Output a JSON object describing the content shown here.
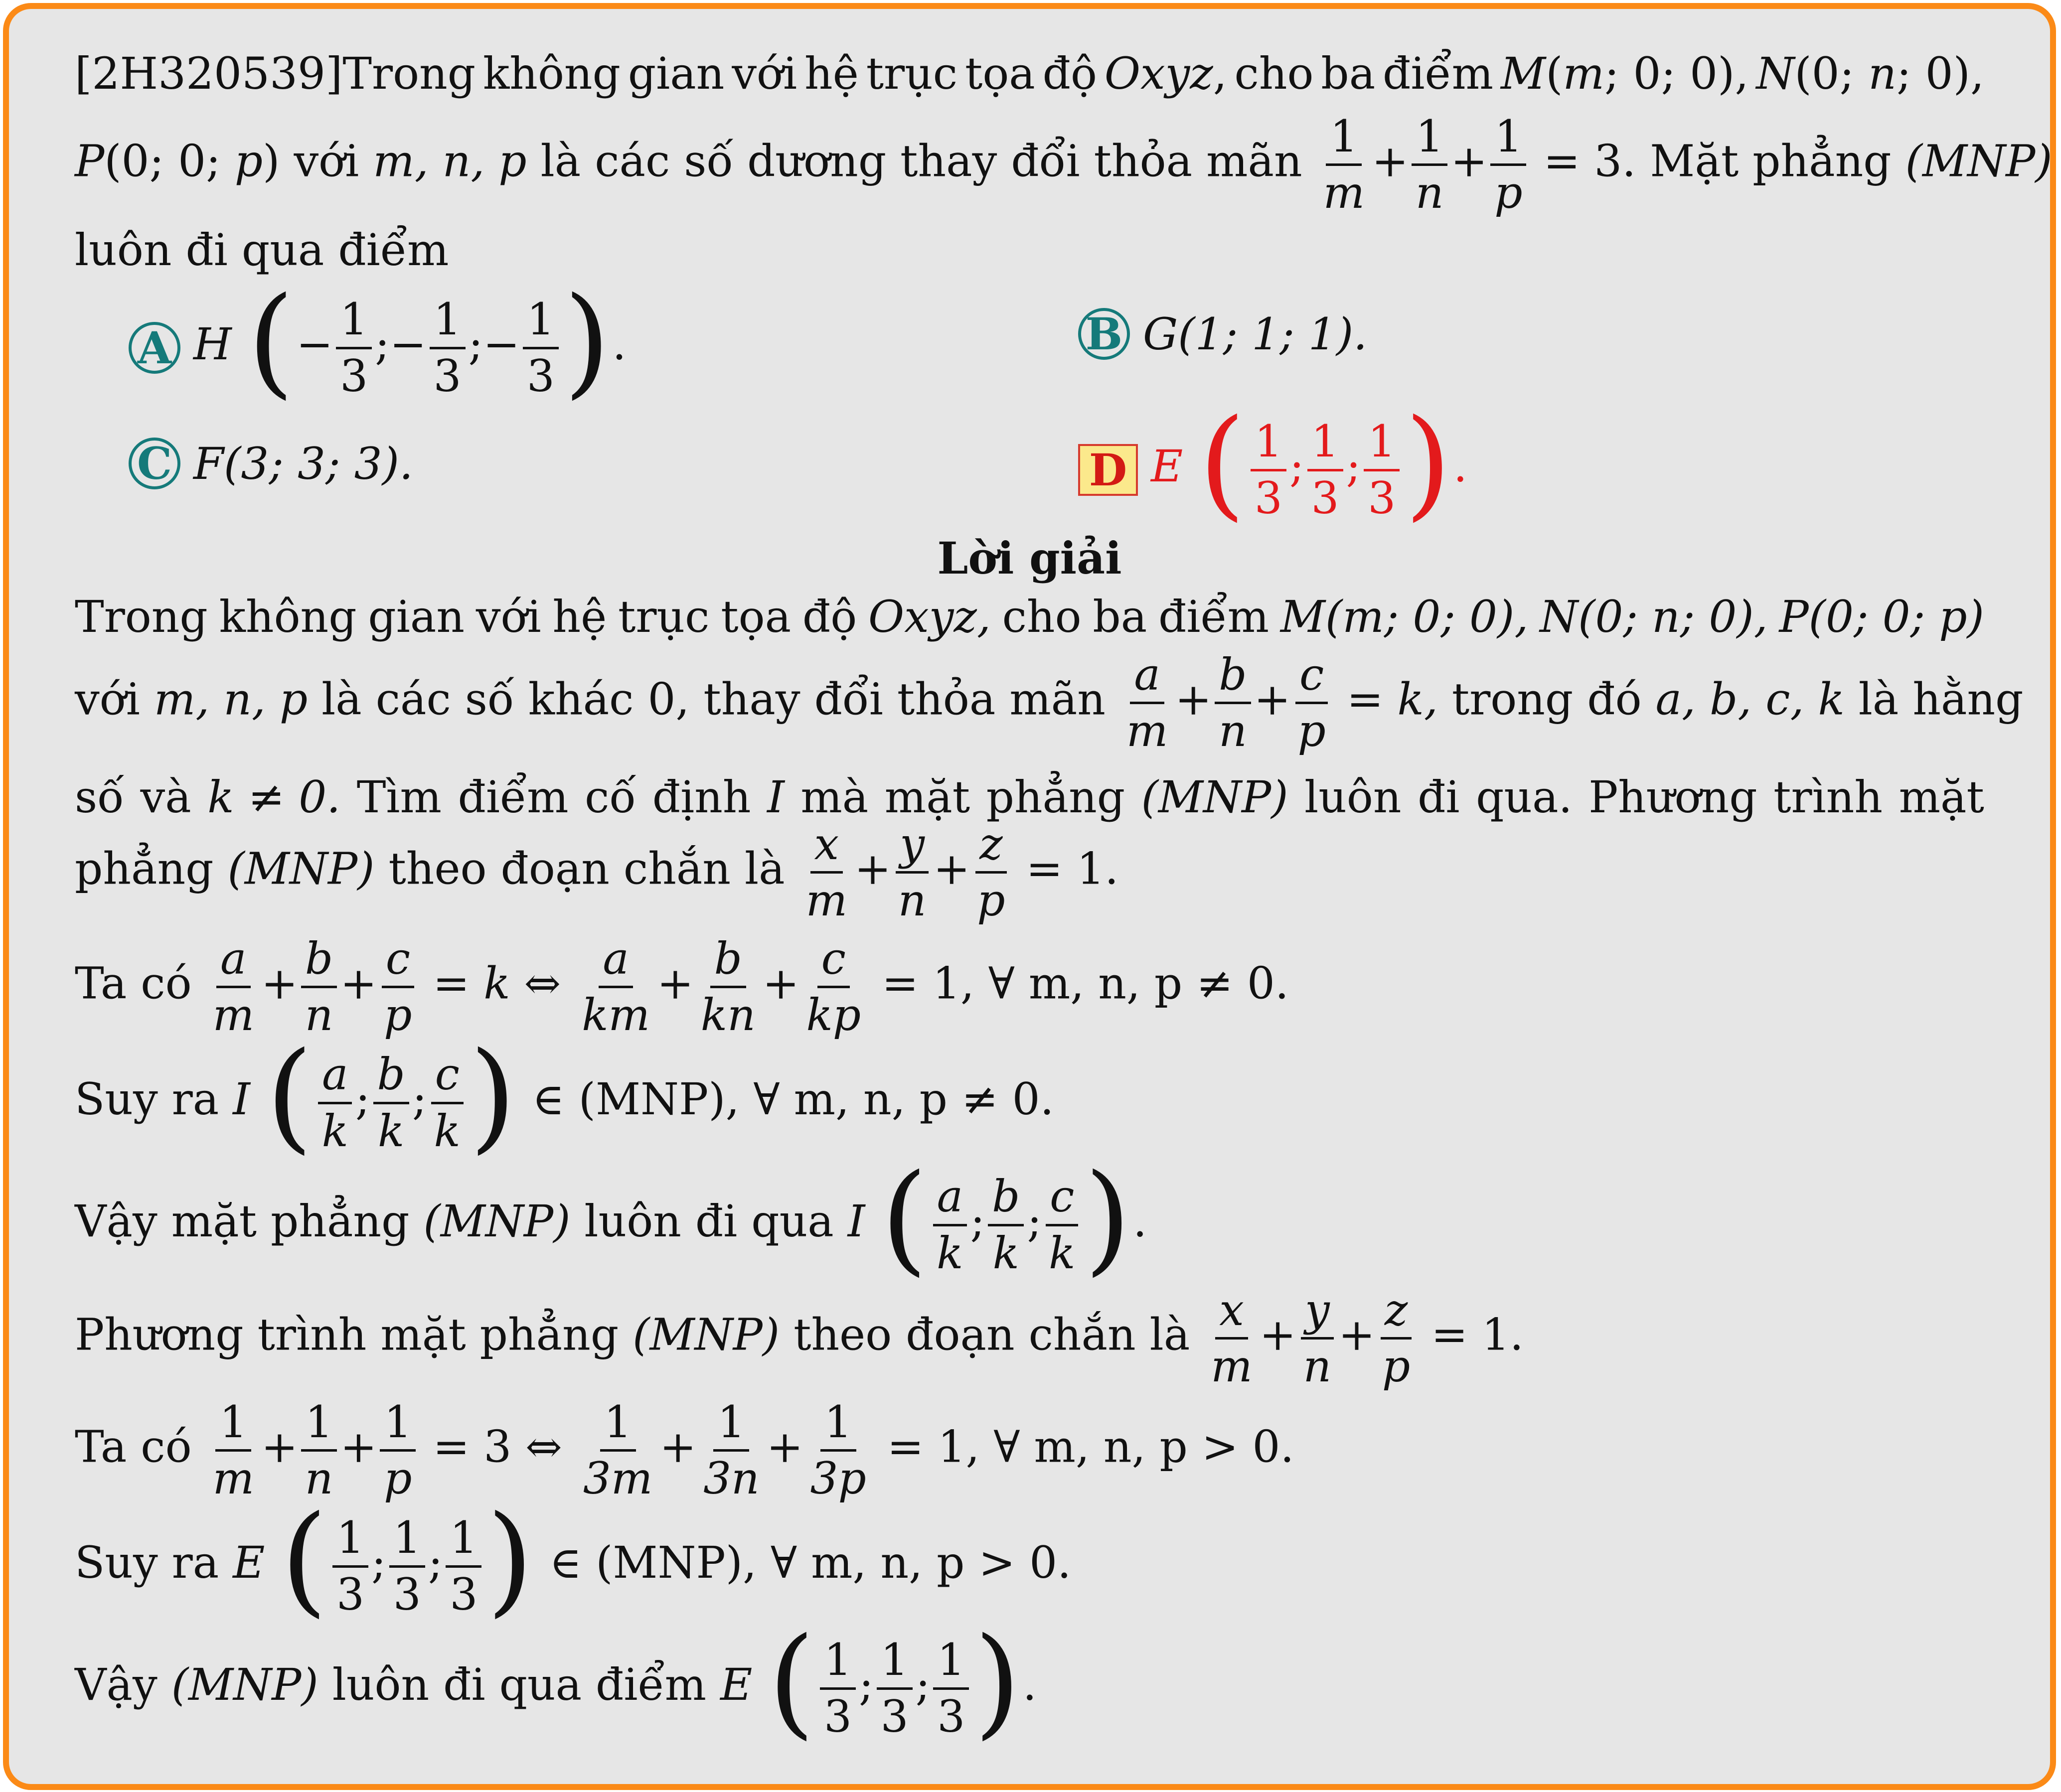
{
  "question": {
    "code": "[2H320539]",
    "line1": {
      "w1": "Trong",
      "w2": "không",
      "w3": "gian",
      "w4": "với",
      "w5": "hệ",
      "w6": "trục",
      "w7": "tọa",
      "w8": "độ",
      "oxyz": "Oxyz",
      "comma1": ",",
      "w9": "cho",
      "w10": "ba",
      "w11": "điểm",
      "M": "M",
      "m": "m",
      "zero": "0",
      "N": "N",
      "n": "n"
    },
    "line2": {
      "P": "P",
      "p": "p",
      "voi": "với",
      "vars": "m, n, p",
      "text": "là các số dương thay đổi thỏa mãn",
      "one": "1",
      "plus": "+",
      "rhs": "= 3.",
      "mat": "Mặt phẳng",
      "mnp": "(MNP)"
    },
    "line3": "luôn đi qua điểm"
  },
  "choices": {
    "A": {
      "label": "A",
      "point": "H",
      "minus": "−",
      "one": "1",
      "three": "3",
      "end": "."
    },
    "B": {
      "label": "B",
      "text": "G(1; 1; 1)."
    },
    "C": {
      "label": "C",
      "text": "F(3; 3; 3)."
    },
    "D": {
      "label": "D",
      "point": "E",
      "one": "1",
      "three": "3",
      "end": "."
    }
  },
  "solution": {
    "heading": "Lời giải",
    "p1_line1": {
      "w1": "Trong",
      "w2": "không",
      "w3": "gian",
      "w4": "với",
      "w5": "hệ",
      "w6": "trục",
      "w7": "tọa",
      "w8": "độ",
      "oxyz": "Oxyz,",
      "w9": "cho",
      "w10": "ba",
      "w11": "điểm",
      "M": "M(m; 0; 0),",
      "N": "N(0; n; 0),",
      "P": "P(0; 0; p)"
    },
    "p1_line2": {
      "pre": "với",
      "vars": "m, n, p",
      "text": "là các số khác 0, thay đổi thỏa mãn",
      "a": "a",
      "b": "b",
      "c": "c",
      "m": "m",
      "n": "n",
      "p": "p",
      "plus": "+",
      "eqk": "= k,",
      "w1": "trong",
      "w2": "đó",
      "abck": "a, b, c, k",
      "w3": "là",
      "w4": "hằng"
    },
    "p1_line3": {
      "w1": "số",
      "w2": "và",
      "k": "k ≠ 0.",
      "w3": "Tìm",
      "w4": "điểm",
      "w5": "cố",
      "w6": "định",
      "I": "I",
      "w7": "mà",
      "w8": "mặt",
      "w9": "phẳng",
      "mnp": "(MNP)",
      "w10": "luôn",
      "w11": "đi",
      "w12": "qua.",
      "w13": "Phương",
      "w14": "trình",
      "w15": "mặt"
    },
    "p1_line4": {
      "text": "phẳng",
      "mnp": "(MNP)",
      "text2": "theo đoạn chắn là",
      "x": "x",
      "y": "y",
      "z": "z",
      "m": "m",
      "n": "n",
      "p": "p",
      "plus": "+",
      "eq1": "= 1."
    },
    "l5": {
      "pre": "Ta có",
      "a": "a",
      "b": "b",
      "c": "c",
      "m": "m",
      "n": "n",
      "p": "p",
      "km": "km",
      "kn": "kn",
      "kp": "kp",
      "plus": "+",
      "eqk": "= k ⇔",
      "tail": "= 1, ∀ m, n, p ≠ 0."
    },
    "l6": {
      "pre": "Suy ra",
      "I": "I",
      "a": "a",
      "b": "b",
      "c": "c",
      "k": "k",
      "tail": "∈ (MNP), ∀ m, n, p ≠ 0."
    },
    "l7": {
      "pre": "Vậy mặt phẳng",
      "mnp": "(MNP)",
      "mid": "luôn đi qua",
      "I": "I",
      "a": "a",
      "b": "b",
      "c": "c",
      "k": "k",
      "end": "."
    },
    "l8": {
      "pre": "Phương trình mặt phẳng",
      "mnp": "(MNP)",
      "mid": "theo đoạn chắn là",
      "x": "x",
      "y": "y",
      "z": "z",
      "m": "m",
      "n": "n",
      "p": "p",
      "plus": "+",
      "eq1": "= 1."
    },
    "l9": {
      "pre": "Ta có",
      "one": "1",
      "m": "m",
      "n": "n",
      "p": "p",
      "m3": "3m",
      "n3": "3n",
      "p3": "3p",
      "plus": "+",
      "eq3": "= 3 ⇔",
      "tail": "= 1, ∀ m, n, p > 0."
    },
    "l10": {
      "pre": "Suy ra",
      "E": "E",
      "one": "1",
      "three": "3",
      "tail": "∈ (MNP), ∀ m, n, p > 0."
    },
    "l11": {
      "pre": "Vậy",
      "mnp": "(MNP)",
      "mid": "luôn đi qua điểm",
      "E": "E",
      "one": "1",
      "three": "3",
      "end": "."
    }
  }
}
